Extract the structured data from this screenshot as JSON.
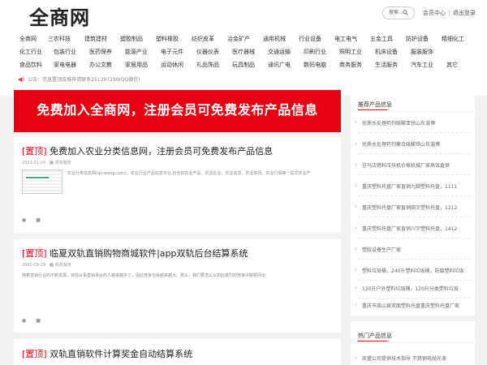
{
  "header": {
    "logo": "全商网",
    "search_placeholder": "搜索...",
    "user_center": "会员中心",
    "separator": "|",
    "logout": "退出登录"
  },
  "categories": [
    [
      "全商网",
      "三农科技",
      "建筑建材",
      "塑胶制品",
      "塑料橡胶",
      "纺织皮革",
      "冶金矿产",
      "通用机械",
      "行业设备",
      "电工电气",
      "五金工具",
      "防护设备",
      "精细化工"
    ],
    [
      "化工行业",
      "包装行业",
      "医药保养",
      "能源产业",
      "电子元件",
      "仪器仪表",
      "医疗器械",
      "交通运输",
      "印刷行业",
      "照明工业",
      "机床设备",
      "服装服饰"
    ],
    [
      "食品饮料",
      "家电电器",
      "办公文教",
      "家居用品",
      "运动休闲",
      "礼品饰品",
      "玩具制品",
      "通讯广电",
      "数码电脑",
      "商务服务",
      "生活服务",
      "汽车工业",
      "其它"
    ]
  ],
  "notice": "公告：信息置顶或推荐请联系251297290(QQ微信)",
  "banner_text": "免费加入全商网，注册会员可免费发布产品信息",
  "posts": [
    {
      "tag": "[置顶]",
      "title": "免费加入农业分类信息网，注册会员可免费发布产品信息",
      "date": "2021-01-24",
      "category": "商务服务",
      "summary": "农业分类信息网(qu-wang.com)，农业行业产品信息平台,包含有农业产品、农业企业、农业信息、农业资讯。农业行情等一站式农业产"
    },
    {
      "tag": "[置顶]",
      "title": "临夏双轨直销购物商城软件|app双轨后台结算系统",
      "date": "2020-09-28",
      "category": "商务服务",
      "summary": "随着直销行业的不断发展，目前从事直销事业的人越来越多了，因此竞争也会越来越大。那么，我们要怎么从如此激烈的竞争中脱颖而出"
    },
    {
      "tag": "[置顶]",
      "title": "双轨直销软件计算奖金自动结算系统"
    }
  ],
  "recommend": {
    "title": "推荐产品信息",
    "items": [
      "优质水处理药剂硫酸亚铁山东淄博",
      "优质水处理药剂聚合硫酸铁山东淄博",
      "驻马店燃料压块机价格机械厂家高效直供",
      "重庆塑料托盘厂家直销九脚塑料托盘，1111",
      "重庆塑料托盘厂家直销田字塑料托盘，1212",
      "重庆塑料托盘厂家直销川字塑料托盘，1412",
      "塑胶设备生产厂家",
      "塑料垃圾桶，240升塑料垃圾桶，防腐塑料垃圾",
      "120升户外塑料垃圾桶，120升分类塑料垃圾",
      "重庆市巫山县双面塑料托盘重庆塑料托盘厂家"
    ]
  },
  "hot": {
    "title": "热门产品信息",
    "items": [
      "凯盟公司提供技术指导 不锈钢电抛光液"
    ]
  }
}
